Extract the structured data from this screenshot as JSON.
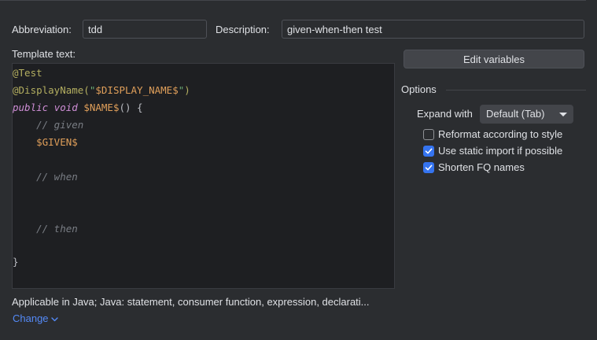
{
  "abbreviation": {
    "label": "Abbreviation:",
    "value": "tdd"
  },
  "description": {
    "label": "Description:",
    "value": "given-when-then test"
  },
  "template": {
    "label": "Template text:",
    "lines": {
      "l1": {
        "t1": "@Test"
      },
      "l2": {
        "t1": "@DisplayName(",
        "t2": "\"",
        "t3": "$DISPLAY_NAME$",
        "t4": "\"",
        "t5": ")"
      },
      "l3": {
        "t1": "public",
        "t2": " ",
        "t3": "void",
        "t4": " ",
        "t5": "$NAME$",
        "t6": "() {"
      },
      "l4": {
        "t1": "    // given"
      },
      "l5": {
        "t1": "    ",
        "t2": "$GIVEN$"
      },
      "l7": {
        "t1": "    // when"
      },
      "l10": {
        "t1": "    // then"
      },
      "l13": {
        "t1": "}"
      }
    },
    "scroll_position": 0
  },
  "edit_variables_label": "Edit variables",
  "options": {
    "title": "Options",
    "expand_with_label": "Expand with",
    "expand_with_value": "Default (Tab)",
    "checkboxes": [
      {
        "label": "Reformat according to style",
        "checked": false
      },
      {
        "label": "Use static import if possible",
        "checked": true
      },
      {
        "label": "Shorten FQ names",
        "checked": true
      }
    ]
  },
  "applicable_text": "Applicable in Java; Java: statement, consumer function, expression, declarati...",
  "change_label": "Change",
  "colors": {
    "background": "#2b2d30",
    "editor_background": "#1e1f22",
    "checkbox_accent": "#3574f0",
    "link": "#548af7"
  }
}
